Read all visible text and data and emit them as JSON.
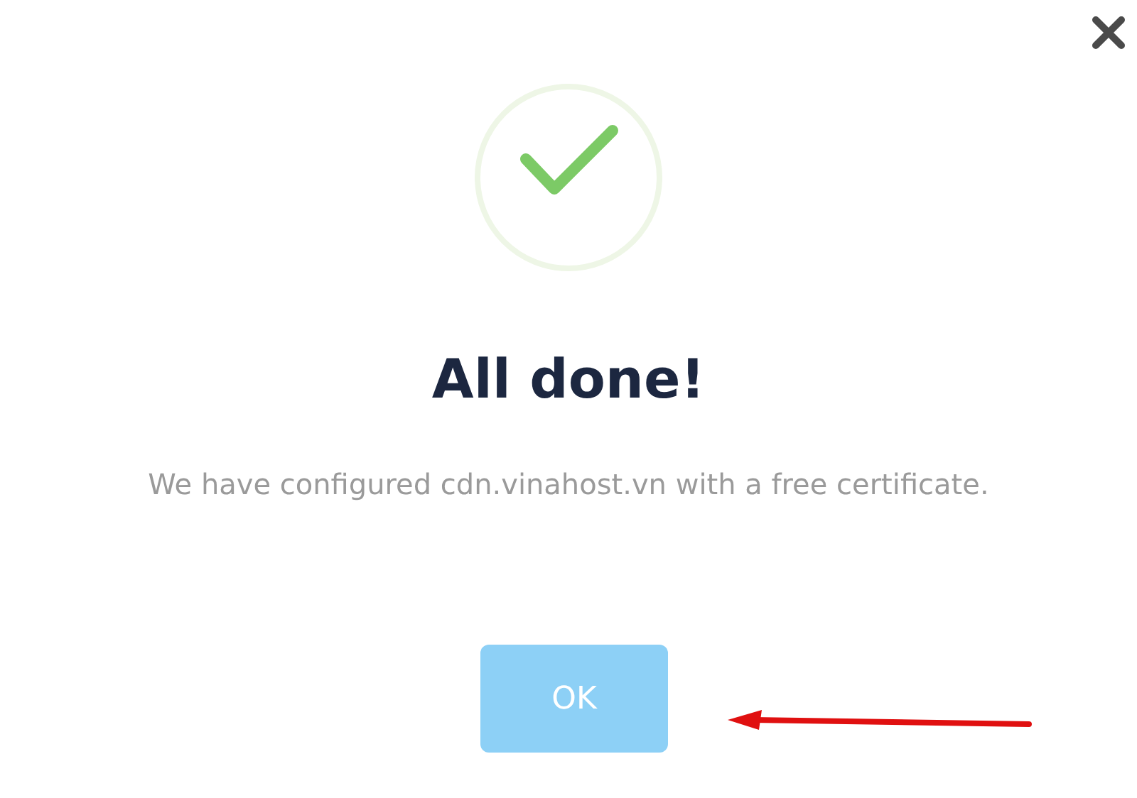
{
  "dialog": {
    "title": "All done!",
    "message": "We have configured cdn.vinahost.vn with a free certificate.",
    "buttons": [
      "OK"
    ]
  }
}
